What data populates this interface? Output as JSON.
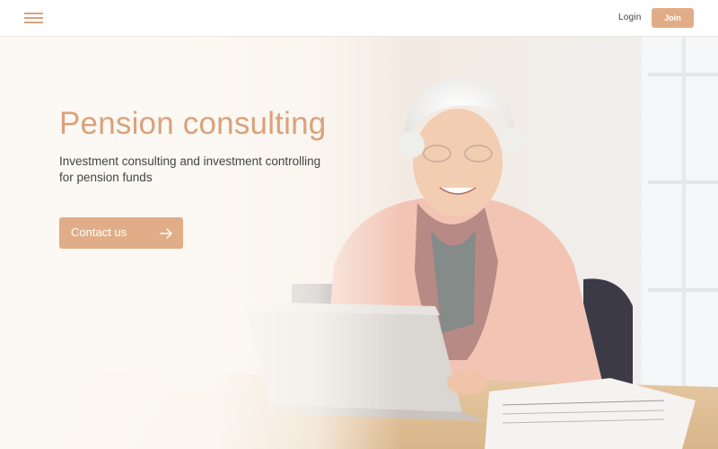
{
  "header": {
    "menu_icon": "hamburger-menu-icon",
    "login_label": "Login",
    "join_label": "Join"
  },
  "hero": {
    "title": "Pension consulting",
    "subtitle": "Investment consulting and investment controlling for pension funds",
    "cta_label": "Contact us",
    "cta_icon": "arrow-right-icon"
  },
  "colors": {
    "accent": "#e1ad88",
    "title": "#d9a27c",
    "text": "#444444",
    "background": "#fbf7f2"
  }
}
